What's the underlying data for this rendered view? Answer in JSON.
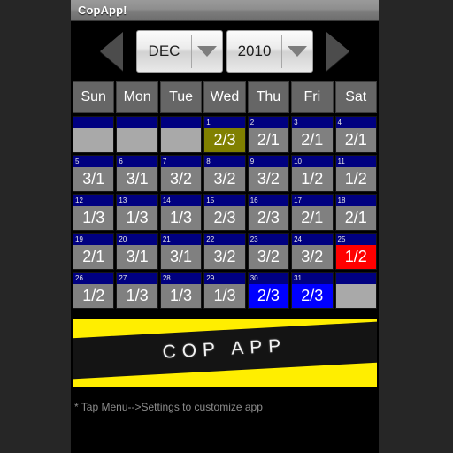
{
  "window": {
    "title": "CopApp!"
  },
  "nav": {
    "prev_label": "◀",
    "next_label": "▶",
    "month_value": "DEC",
    "year_value": "2010",
    "caret_label": "▼"
  },
  "calendar": {
    "day_headers": [
      "Sun",
      "Mon",
      "Tue",
      "Wed",
      "Thu",
      "Fri",
      "Sat"
    ],
    "weeks": [
      [
        {
          "num": "",
          "shift": "",
          "style": "empty"
        },
        {
          "num": "",
          "shift": "",
          "style": "empty"
        },
        {
          "num": "",
          "shift": "",
          "style": "empty"
        },
        {
          "num": "1",
          "shift": "2/3",
          "style": "today"
        },
        {
          "num": "2",
          "shift": "2/1",
          "style": "default"
        },
        {
          "num": "3",
          "shift": "2/1",
          "style": "default"
        },
        {
          "num": "4",
          "shift": "2/1",
          "style": "default"
        }
      ],
      [
        {
          "num": "5",
          "shift": "3/1",
          "style": "default"
        },
        {
          "num": "6",
          "shift": "3/1",
          "style": "default"
        },
        {
          "num": "7",
          "shift": "3/2",
          "style": "default"
        },
        {
          "num": "8",
          "shift": "3/2",
          "style": "default"
        },
        {
          "num": "9",
          "shift": "3/2",
          "style": "default"
        },
        {
          "num": "10",
          "shift": "1/2",
          "style": "default"
        },
        {
          "num": "11",
          "shift": "1/2",
          "style": "default"
        }
      ],
      [
        {
          "num": "12",
          "shift": "1/3",
          "style": "default"
        },
        {
          "num": "13",
          "shift": "1/3",
          "style": "default"
        },
        {
          "num": "14",
          "shift": "1/3",
          "style": "default"
        },
        {
          "num": "15",
          "shift": "2/3",
          "style": "default"
        },
        {
          "num": "16",
          "shift": "2/3",
          "style": "default"
        },
        {
          "num": "17",
          "shift": "2/1",
          "style": "default"
        },
        {
          "num": "18",
          "shift": "2/1",
          "style": "default"
        }
      ],
      [
        {
          "num": "19",
          "shift": "2/1",
          "style": "default"
        },
        {
          "num": "20",
          "shift": "3/1",
          "style": "default"
        },
        {
          "num": "21",
          "shift": "3/1",
          "style": "default"
        },
        {
          "num": "22",
          "shift": "3/2",
          "style": "default"
        },
        {
          "num": "23",
          "shift": "3/2",
          "style": "default"
        },
        {
          "num": "24",
          "shift": "3/2",
          "style": "default"
        },
        {
          "num": "25",
          "shift": "1/2",
          "style": "red"
        }
      ],
      [
        {
          "num": "26",
          "shift": "1/2",
          "style": "default"
        },
        {
          "num": "27",
          "shift": "1/3",
          "style": "default"
        },
        {
          "num": "28",
          "shift": "1/3",
          "style": "default"
        },
        {
          "num": "29",
          "shift": "1/3",
          "style": "default"
        },
        {
          "num": "30",
          "shift": "2/3",
          "style": "blue"
        },
        {
          "num": "31",
          "shift": "2/3",
          "style": "blue"
        },
        {
          "num": "",
          "shift": "",
          "style": "empty"
        }
      ]
    ]
  },
  "banner": {
    "text": "COP APP",
    "background_color": "#ffee00",
    "bar_color": "#141414"
  },
  "footer": {
    "hint": "* Tap Menu-->Settings to customize app"
  },
  "colors": {
    "navy_strip": "#000080",
    "cell_default": "#808080",
    "cell_today": "#808000",
    "cell_red": "#ff0000",
    "cell_blue": "#0000ff",
    "cell_empty": "#a9a9a9",
    "header_gray": "#666666"
  }
}
